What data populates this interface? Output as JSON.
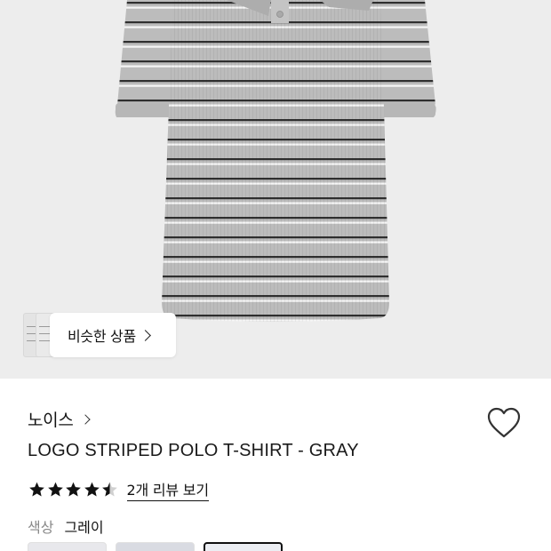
{
  "product_image": {
    "similar_products_label": "비슷한 상품"
  },
  "brand": {
    "name": "노이스"
  },
  "product": {
    "title": "LOGO STRIPED POLO T-SHIRT - GRAY",
    "rating": 4.5,
    "review_link": "2개 리뷰 보기"
  },
  "color_option": {
    "label": "색상",
    "value": "그레이",
    "selected_index": 2
  },
  "colors": {
    "shirt": "#bdbdbd",
    "stripe_dark": "#3a3a3a",
    "stripe_light": "#f5f5f5",
    "background": "#ededed"
  }
}
